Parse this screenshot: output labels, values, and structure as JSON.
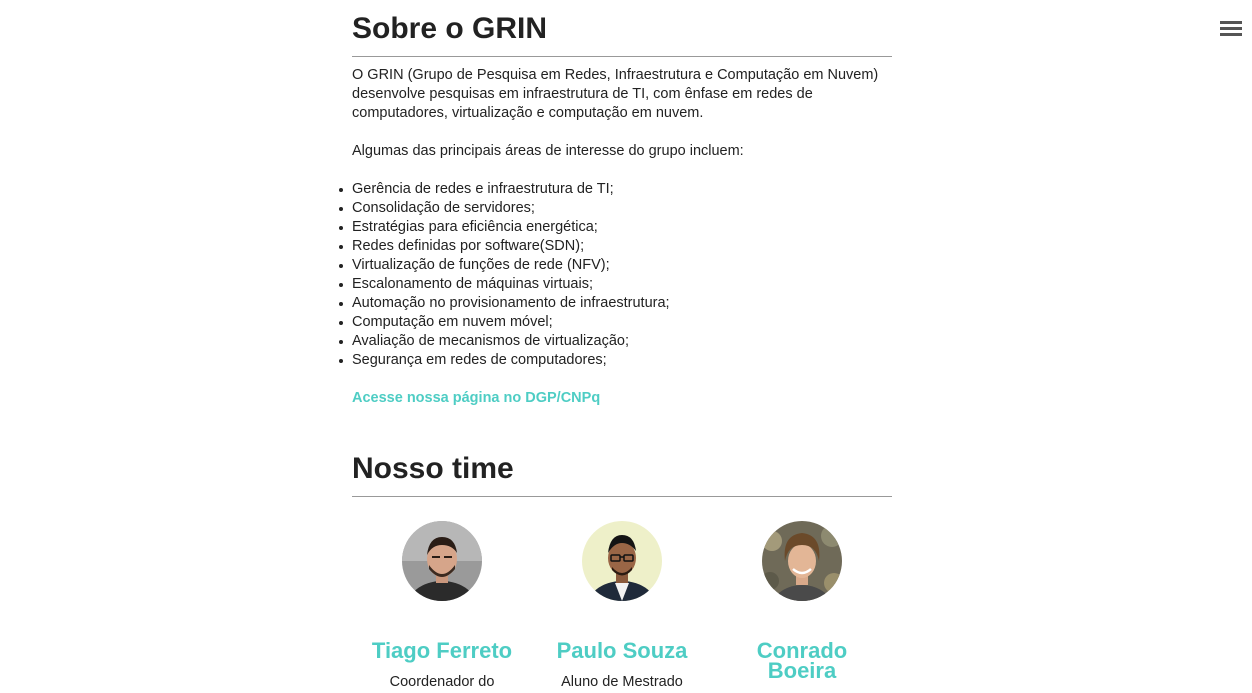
{
  "header": {
    "menu_icon": "hamburger-menu-icon"
  },
  "about": {
    "title": "Sobre o GRIN",
    "intro": "O GRIN (Grupo de Pesquisa em Redes, Infraestrutura e Computação em Nuvem) desenvolve pesquisas em infraestrutura de TI, com ênfase em redes de computadores, virtualização e computação em nuvem.",
    "areas_intro": "Algumas das principais áreas de interesse do grupo incluem:",
    "areas": [
      "Gerência de redes e infraestrutura de TI;",
      "Consolidação de servidores;",
      "Estratégias para eficiência energética;",
      "Redes definidas por software(SDN);",
      "Virtualização de funções de rede (NFV);",
      "Escalonamento de máquinas virtuais;",
      "Automação no provisionamento de infraestrutura;",
      "Computação em nuvem móvel;",
      "Avaliação de mecanismos de virtualização;",
      "Segurança em redes de computadores;"
    ],
    "link_label": "Acesse nossa página no DGP/CNPq",
    "accent_color": "#4ecdc4"
  },
  "team": {
    "title": "Nosso time",
    "members": [
      {
        "name": "Tiago Ferreto",
        "role": "Coordenador do"
      },
      {
        "name": "Paulo Souza",
        "role": "Aluno de Mestrado"
      },
      {
        "name": "Conrado Boeira",
        "role": ""
      }
    ]
  }
}
